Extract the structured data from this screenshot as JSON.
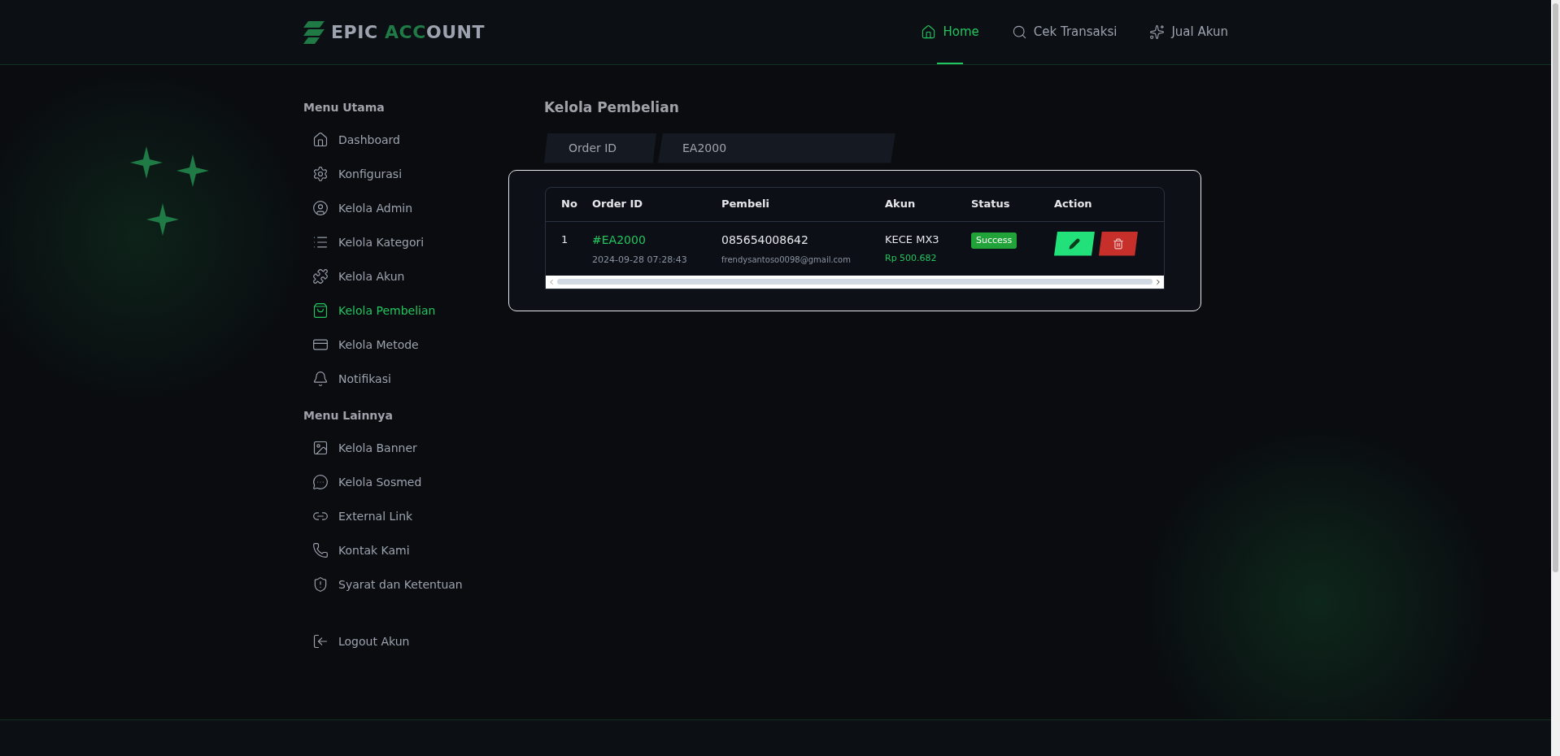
{
  "header": {
    "logo": {
      "part_1": "EPIC",
      "part_2": "ACC",
      "part_3": "OUNT"
    },
    "nav": [
      {
        "label": "Home",
        "selected": true
      },
      {
        "label": "Cek Transaksi",
        "selected": false
      },
      {
        "label": "Jual Akun",
        "selected": false
      }
    ]
  },
  "sidebar": {
    "sections": [
      {
        "title": "Menu Utama",
        "items": [
          {
            "label": "Dashboard",
            "selected": false
          },
          {
            "label": "Konfigurasi",
            "selected": false
          },
          {
            "label": "Kelola Admin",
            "selected": false
          },
          {
            "label": "Kelola Kategori",
            "selected": false
          },
          {
            "label": "Kelola Akun",
            "selected": false
          },
          {
            "label": "Kelola Pembelian",
            "selected": true
          },
          {
            "label": "Kelola Metode",
            "selected": false
          },
          {
            "label": "Notifikasi",
            "selected": false
          }
        ]
      },
      {
        "title": "Menu Lainnya",
        "items": [
          {
            "label": "Kelola Banner",
            "selected": false
          },
          {
            "label": "Kelola Sosmed",
            "selected": false
          },
          {
            "label": "External Link",
            "selected": false
          },
          {
            "label": "Kontak Kami",
            "selected": false
          },
          {
            "label": "Syarat dan Ketentuan",
            "selected": false
          }
        ]
      }
    ],
    "logout": {
      "label": "Logout Akun"
    }
  },
  "main": {
    "title": "Kelola Pembelian",
    "filter": {
      "label": "Order ID",
      "value": "EA2000"
    },
    "table": {
      "columns": [
        "No",
        "Order ID",
        "Pembeli",
        "Akun",
        "Status",
        "Action"
      ],
      "rows": [
        {
          "no": "1",
          "order_id": "#EA2000",
          "date": "2024-09-28 07:28:43",
          "phone": "085654008642",
          "email": "frendysantoso0098@gmail.com",
          "account": "KECE MX3",
          "price": "Rp 500.682",
          "status": "Success"
        }
      ]
    }
  }
}
